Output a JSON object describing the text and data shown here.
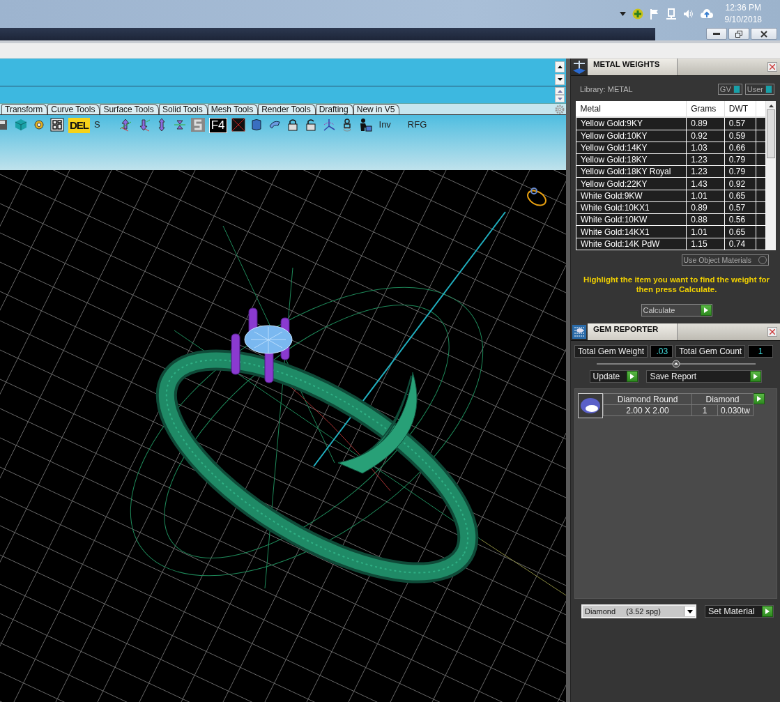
{
  "system_tray": {
    "time": "12:36 PM",
    "date": "9/10/2018"
  },
  "tabs": [
    {
      "label": "Transform",
      "selected": false
    },
    {
      "label": "Curve Tools",
      "selected": false
    },
    {
      "label": "Surface Tools",
      "selected": false
    },
    {
      "label": "Solid Tools",
      "selected": false
    },
    {
      "label": "Mesh Tools",
      "selected": false
    },
    {
      "label": "Render Tools",
      "selected": false
    },
    {
      "label": "Drafting",
      "selected": false
    },
    {
      "label": "New in V5",
      "selected": false
    }
  ],
  "toolbar_labels": [
    "DEL",
    "S",
    "F4",
    "Inv",
    "RFG"
  ],
  "metal_weights": {
    "title": "METAL WEIGHTS",
    "library": "Library: METAL",
    "toggles": [
      {
        "label": "GV",
        "on": true
      },
      {
        "label": "User",
        "on": true
      }
    ],
    "columns": [
      "Metal",
      "Grams",
      "DWT"
    ],
    "rows": [
      [
        "Yellow Gold:9KY",
        "0.89",
        "0.57"
      ],
      [
        "Yellow Gold:10KY",
        "0.92",
        "0.59"
      ],
      [
        "Yellow Gold:14KY",
        "1.03",
        "0.66"
      ],
      [
        "Yellow Gold:18KY",
        "1.23",
        "0.79"
      ],
      [
        "Yellow Gold:18KY Royal",
        "1.23",
        "0.79"
      ],
      [
        "Yellow Gold:22KY",
        "1.43",
        "0.92"
      ],
      [
        "White Gold:9KW",
        "1.01",
        "0.65"
      ],
      [
        "White Gold:10KX1",
        "0.89",
        "0.57"
      ],
      [
        "White Gold:10KW",
        "0.88",
        "0.56"
      ],
      [
        "White Gold:14KX1",
        "1.01",
        "0.65"
      ],
      [
        "White Gold:14K PdW",
        "1.15",
        "0.74"
      ]
    ],
    "use_object_materials": {
      "label": "Use Object Materials",
      "checked": false
    },
    "message": "Highlight the item you want to find the weight for then press Calculate.",
    "calculate": "Calculate"
  },
  "gem_reporter": {
    "title": "GEM REPORTER",
    "total_weight": {
      "label": "Total Gem Weight",
      "value": ".03"
    },
    "total_count": {
      "label": "Total Gem Count",
      "value": "1"
    },
    "buttons": [
      "Update",
      "Save Report"
    ],
    "gems": [
      {
        "shape": "Diamond Round",
        "material": "Diamond",
        "size": "2.00 X 2.00",
        "count": "1",
        "weight": "0.030tw"
      }
    ],
    "material_select": "Diamond     (3.52 spg)",
    "set_material": "Set Material"
  }
}
